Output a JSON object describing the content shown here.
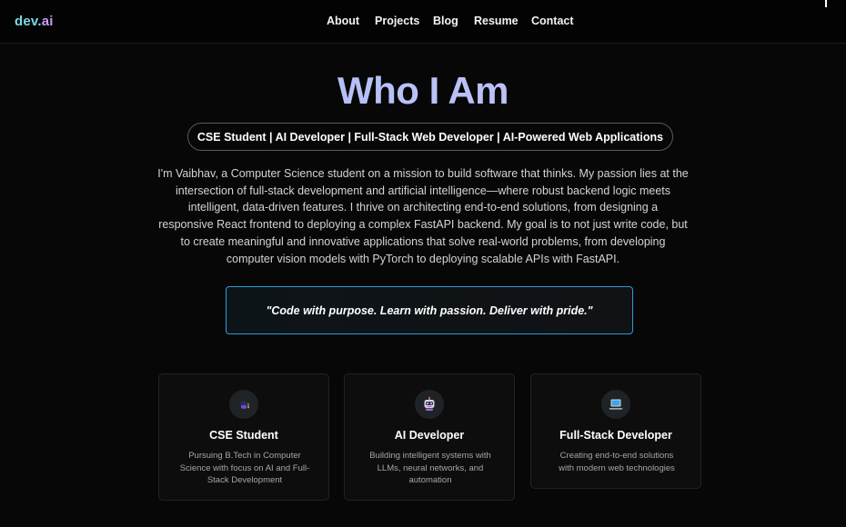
{
  "nav": {
    "logo_part1": "dev.",
    "logo_part2": "ai",
    "links": [
      "About",
      "Projects",
      "Blog",
      "Resume",
      "Contact"
    ]
  },
  "hero": {
    "title": "Who I Am",
    "roles": "CSE Student | AI Developer | Full-Stack Web Developer | AI-Powered Web Applications",
    "bio_lines": [
      "I'm Vaibhav, a Computer Science student on a mission to build software that thinks. My passion lies at the",
      "intersection of full-stack development and artificial intelligence—where robust backend logic meets",
      "intelligent, data-driven features. I thrive on architecting end-to-end solutions, from designing a",
      "responsive React frontend to deploying a complex FastAPI backend. My goal is to not just write code, but",
      "to create meaningful and innovative applications that solve real-world problems, from developing",
      "computer vision models with PyTorch to deploying scalable APIs with FastAPI."
    ],
    "quote": "\"Code with purpose. Learn with passion. Deliver with pride.\""
  },
  "cards": [
    {
      "icon": "graduation-cap-icon",
      "title": "CSE Student",
      "desc_lines": [
        "Pursuing B.Tech in Computer",
        "Science with focus on AI and Full-",
        "Stack Development"
      ]
    },
    {
      "icon": "robot-icon",
      "title": "AI Developer",
      "desc_lines": [
        "Building intelligent systems with",
        "LLMs, neural networks, and",
        "automation"
      ]
    },
    {
      "icon": "laptop-icon",
      "title": "Full-Stack Developer",
      "desc_lines": [
        "Creating end-to-end solutions",
        "with modern web technologies"
      ]
    }
  ],
  "colors": {
    "background": "#070707",
    "logo_dev": "#7ad9e8",
    "logo_ai": "#c79cf2",
    "title_gradient_start": "#a5b8f5",
    "title_gradient_end": "#c7b6f2",
    "quote_border": "#2a9cd6"
  }
}
